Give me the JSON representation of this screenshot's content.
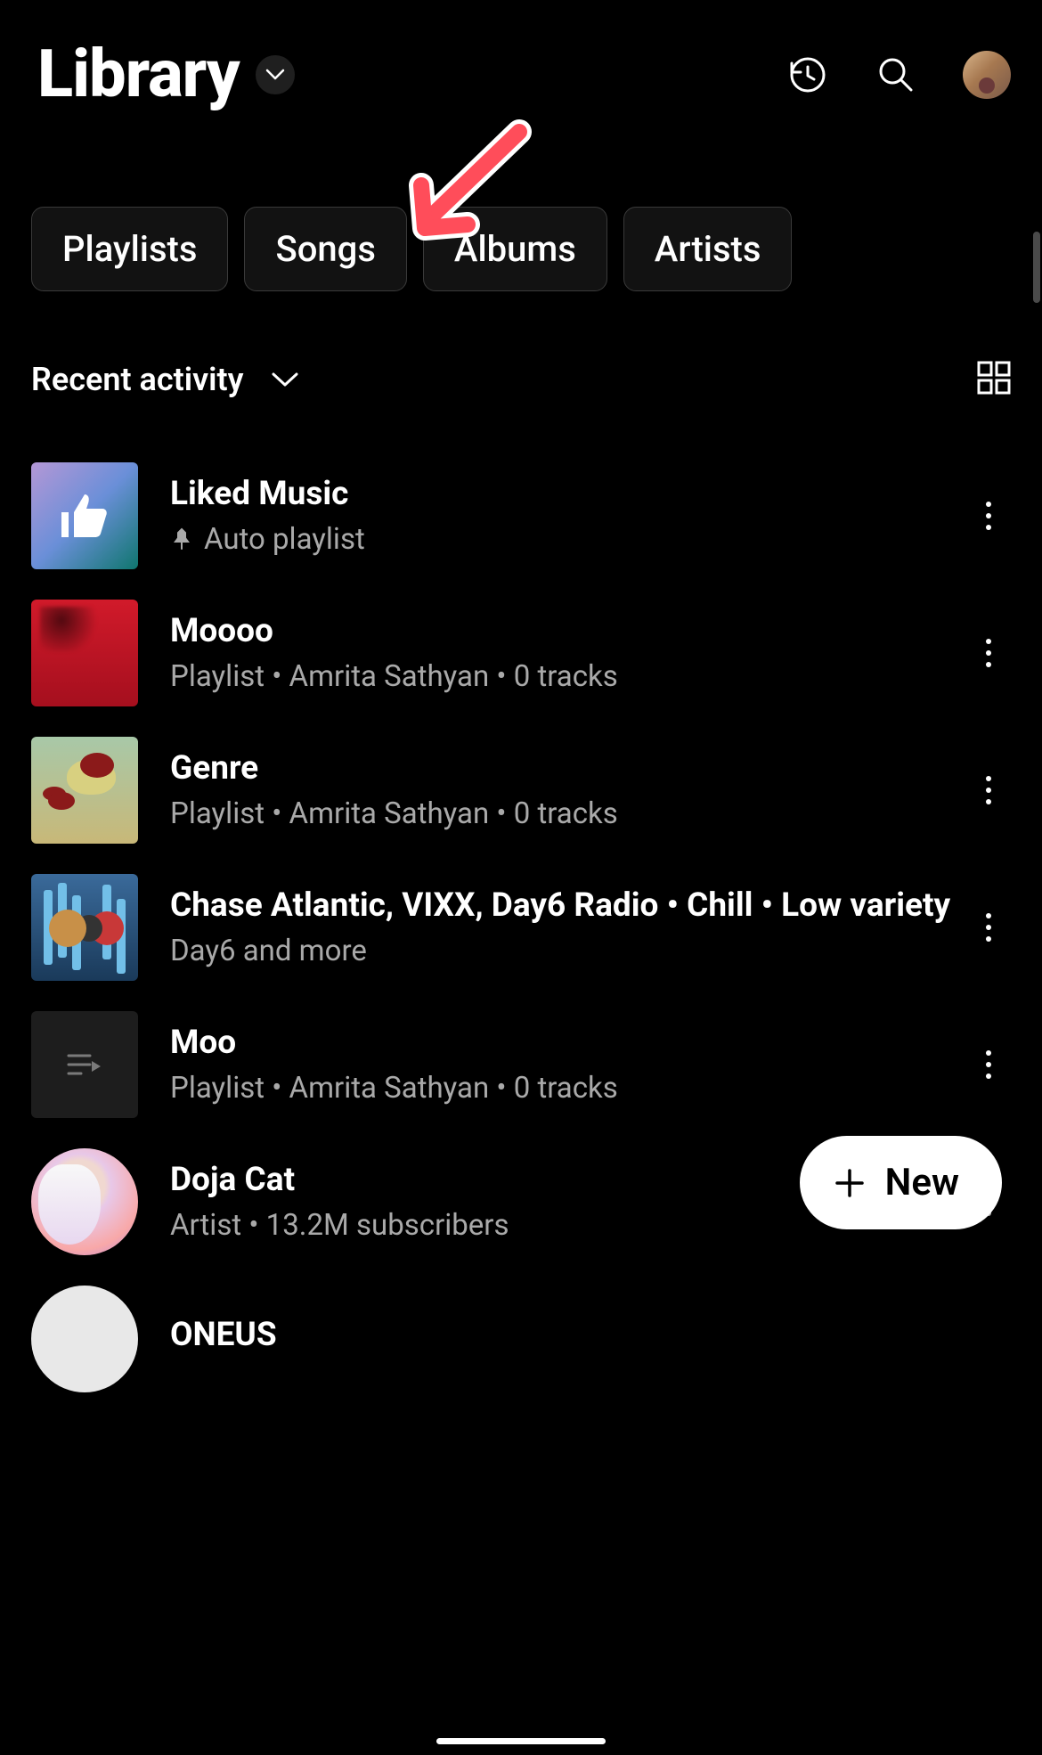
{
  "header": {
    "title": "Library"
  },
  "chips": [
    "Playlists",
    "Songs",
    "Albums",
    "Artists"
  ],
  "sort": {
    "label": "Recent activity"
  },
  "items": [
    {
      "title": "Liked Music",
      "subtitle": "Auto playlist",
      "pinned": true
    },
    {
      "title": "Moooo",
      "subtitle": "Playlist • Amrita Sathyan • 0 tracks"
    },
    {
      "title": "Genre",
      "subtitle": "Playlist • Amrita Sathyan • 0 tracks"
    },
    {
      "title": "Chase Atlantic, VIXX, Day6 Radio • Chill • Low variety",
      "subtitle": "Day6 and more"
    },
    {
      "title": "Moo",
      "subtitle": "Playlist • Amrita Sathyan • 0 tracks"
    },
    {
      "title": "Doja Cat",
      "subtitle": "Artist • 13.2M subscribers"
    },
    {
      "title": "ONEUS",
      "subtitle": ""
    }
  ],
  "fab": {
    "label": "New"
  }
}
